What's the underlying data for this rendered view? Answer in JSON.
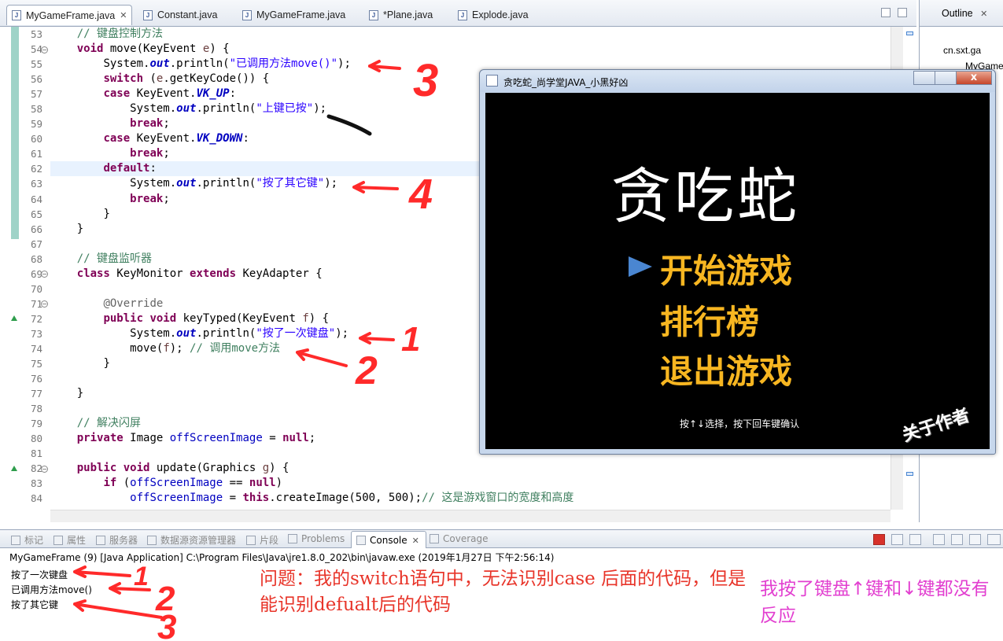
{
  "editor_tabs": [
    {
      "label": "MyGameFrame.java",
      "active": true,
      "close": "✕"
    },
    {
      "label": "Constant.java",
      "active": false
    },
    {
      "label": "MyGameFrame.java",
      "active": false
    },
    {
      "label": "*Plane.java",
      "active": false
    },
    {
      "label": "Explode.java",
      "active": false
    }
  ],
  "line_numbers": [
    "53",
    "54",
    "55",
    "56",
    "57",
    "58",
    "59",
    "60",
    "61",
    "62",
    "63",
    "64",
    "65",
    "66",
    "67",
    "68",
    "69",
    "70",
    "71",
    "72",
    "73",
    "74",
    "75",
    "76",
    "77",
    "78",
    "79",
    "80",
    "81",
    "82",
    "83",
    "84"
  ],
  "code": {
    "l53_comment": "// 键盘控制方法",
    "l54_kw": "void",
    "l54_sig": " move(KeyEvent ",
    "l54_param": "e",
    "l54_end": ") {",
    "l55_pre": "System.",
    "l55_out": "out",
    "l55_mid": ".println(",
    "l55_str": "\"已调用方法move()\"",
    "l55_end": ");",
    "l56_kw": "switch",
    "l56_a": " (",
    "l56_param": "e",
    "l56_b": ".getKeyCode()) {",
    "l57_kw": "case",
    "l57_a": " KeyEvent.",
    "l57_const": "VK_UP",
    "l57_b": ":",
    "l58_pre": "System.",
    "l58_out": "out",
    "l58_mid": ".println(",
    "l58_str": "\"上键已按\"",
    "l58_end": ");",
    "l59_kw": "break",
    "l59_end": ";",
    "l60_kw": "case",
    "l60_a": " KeyEvent.",
    "l60_const": "VK_DOWN",
    "l60_b": ":",
    "l61_kw": "break",
    "l61_end": ";",
    "l62_kw": "default",
    "l62_end": ":",
    "l63_pre": "System.",
    "l63_out": "out",
    "l63_mid": ".println(",
    "l63_str": "\"按了其它键\"",
    "l63_end": ");",
    "l64_kw": "break",
    "l64_end": ";",
    "l65": "}",
    "l66": "}",
    "l68_comment": "// 键盘监听器",
    "l69_kw": "class",
    "l69_a": " KeyMonitor ",
    "l69_kw2": "extends",
    "l69_b": " KeyAdapter {",
    "l71_ann": "@Override",
    "l72_kw": "public void",
    "l72_a": " keyTyped(KeyEvent ",
    "l72_param": "f",
    "l72_b": ") {",
    "l73_pre": "System.",
    "l73_out": "out",
    "l73_mid": ".println(",
    "l73_str": "\"按了一次键盘\"",
    "l73_end": ");",
    "l74_a": "move(",
    "l74_param": "f",
    "l74_b": "); ",
    "l74_comment": "// 调用move方法",
    "l75": "}",
    "l77": "}",
    "l79_comment": "// 解决闪屏",
    "l80_kw": "private",
    "l80_a": " Image ",
    "l80_field": "offScreenImage",
    "l80_b": " = ",
    "l80_kw2": "null",
    "l80_end": ";",
    "l82_kw": "public void",
    "l82_a": " update(Graphics ",
    "l82_param": "g",
    "l82_b": ") {",
    "l83_kw": "if",
    "l83_a": " (",
    "l83_field": "offScreenImage",
    "l83_b": " == ",
    "l83_kw2": "null",
    "l83_end": ")",
    "l84_field": "offScreenImage",
    "l84_a": " = ",
    "l84_kw": "this",
    "l84_b": ".createImage(500, 500);",
    "l84_comment": "// 这是游戏窗口的宽度和高度"
  },
  "outline": {
    "title": "Outline",
    "close": "✕",
    "items": [
      "cn.sxt.ga",
      "MyGame"
    ]
  },
  "game_window": {
    "title": "贪吃蛇_尚学堂JAVA_小黑好凶",
    "logo": "贪吃蛇",
    "menu": [
      "开始游戏",
      "排行榜",
      "退出游戏"
    ],
    "hint": "按↑↓选择，按下回车键确认",
    "about": "关于作者",
    "close": "x"
  },
  "view_tabs": [
    {
      "label": "标记",
      "active": false
    },
    {
      "label": "属性",
      "active": false
    },
    {
      "label": "服务器",
      "active": false
    },
    {
      "label": "数据源资源管理器",
      "active": false
    },
    {
      "label": "片段",
      "active": false
    },
    {
      "label": "Problems",
      "active": false
    },
    {
      "label": "Console",
      "active": true,
      "close": "✕"
    },
    {
      "label": "Coverage",
      "active": false
    }
  ],
  "console": {
    "header": "MyGameFrame (9) [Java Application] C:\\Program Files\\Java\\jre1.8.0_202\\bin\\javaw.exe (2019年1月27日 下午2:56:14)",
    "lines": [
      "按了一次键盘",
      "已调用方法move()",
      "按了其它键"
    ]
  },
  "annotations": {
    "question": "问题：我的switch语句中，无法识别case 后面的代码，但是能识别defualt后的代码",
    "note": "我按了键盘↑键和↓键都没有反应",
    "editor_marks": [
      "3",
      "4",
      "1",
      "2"
    ],
    "console_marks": [
      "1",
      "2",
      "3"
    ],
    "mark_color": "#ff2a2a"
  },
  "colors": {
    "keyword": "#7f0055",
    "comment": "#3f7f5f",
    "string": "#2a00ff",
    "field": "#0000c0",
    "menu_text": "#f7b621",
    "question_text": "#e8352a",
    "note_text": "#e23fd0"
  }
}
